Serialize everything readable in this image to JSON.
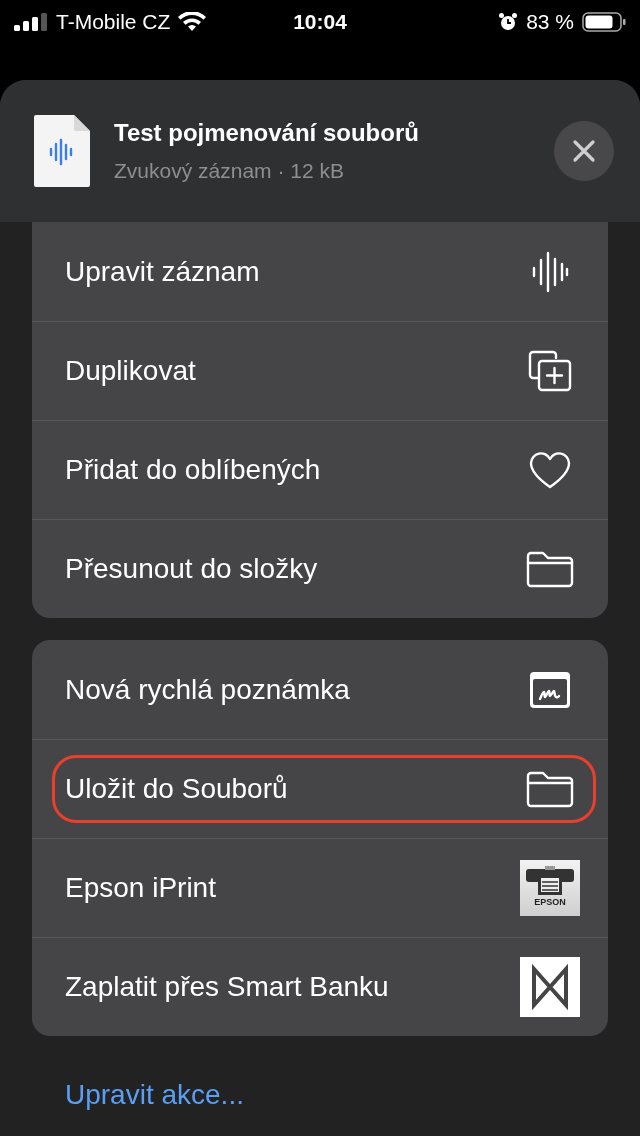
{
  "status_bar": {
    "carrier": "T-Mobile CZ",
    "time": "10:04",
    "battery": "83 %"
  },
  "header": {
    "title": "Test pojmenování souborů",
    "subtitle": "Zvukový záznam · 12 kB"
  },
  "groups": [
    {
      "items": [
        {
          "label": "Upravit záznam",
          "kind": "waveform",
          "highlighted": false
        },
        {
          "label": "Duplikovat",
          "kind": "duplicate",
          "highlighted": false
        },
        {
          "label": "Přidat do oblíbených",
          "kind": "heart",
          "highlighted": false
        },
        {
          "label": "Přesunout do složky",
          "kind": "folder",
          "highlighted": false
        }
      ]
    },
    {
      "items": [
        {
          "label": "Nová rychlá poznámka",
          "kind": "note",
          "highlighted": false
        },
        {
          "label": "Uložit do Souborů",
          "kind": "folder",
          "highlighted": true
        },
        {
          "label": "Epson iPrint",
          "kind": "printer",
          "icon_caption": "EPSON",
          "highlighted": false
        },
        {
          "label": "Zaplatit přes Smart Banku",
          "kind": "bank",
          "highlighted": false
        }
      ]
    }
  ],
  "edit_actions": "Upravit akce..."
}
